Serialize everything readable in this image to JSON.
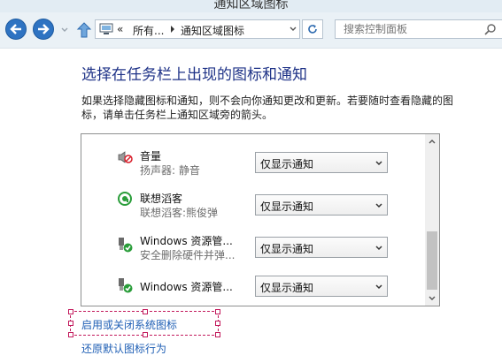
{
  "window": {
    "title": "通知区域图标"
  },
  "navbar": {
    "address": {
      "overflow": "«",
      "crumbs": [
        "所有...",
        "通知区域图标"
      ]
    },
    "search": {
      "placeholder": "搜索控制面板"
    }
  },
  "main": {
    "heading": "选择在任务栏上出现的图标和通知",
    "description": "如果选择隐藏图标和通知，则不会向你通知更改和更新。若要随时查看隐藏的图标，请单击任务栏上通知区域旁的箭头。",
    "items": [
      {
        "name": "音量",
        "subtitle": "扬声器: 静音",
        "behavior": "仅显示通知",
        "icon": "speaker-muted-icon"
      },
      {
        "name": "联想滔客",
        "subtitle": "联想滔客:熊俊弹",
        "behavior": "仅显示通知",
        "icon": "lenovo-chat-icon"
      },
      {
        "name": "Windows 资源管...",
        "subtitle": "安全删除硬件并弹...",
        "behavior": "仅显示通知",
        "icon": "usb-safe-remove-icon"
      },
      {
        "name": "Windows 资源管...",
        "subtitle": "",
        "behavior": "仅显示通知",
        "icon": "usb-safe-remove-icon"
      }
    ],
    "links": {
      "toggle_system_icons": "启用或关闭系统图标",
      "restore_defaults": "还原默认图标行为"
    }
  },
  "colors": {
    "heading": "#1e3287",
    "link": "#1f5fb5",
    "nav_button": "#2e73c2"
  }
}
